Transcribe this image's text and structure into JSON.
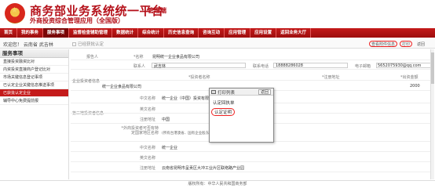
{
  "header": {
    "title": "商务部业务系统统一平台",
    "title_suffix": "管理端",
    "subtitle": "外商投资综合管理应用（全国版）"
  },
  "nav": {
    "items": [
      "首页",
      "我的事务",
      "服务事项",
      "监督检查辅助管理",
      "数据统计",
      "综合统计",
      "历史信息查询",
      "咨询互动",
      "应用管理",
      "应用设置",
      "返回业务大厅"
    ],
    "active_index": 2
  },
  "subbar": {
    "welcome": "欢迎您！ 云南省 武吉林",
    "breadcrumb": "已经获批认定"
  },
  "toolbar": {
    "view_label": "查看附件信息",
    "print_label": "打印",
    "back_label": "返回"
  },
  "sidebar": {
    "heading": "服务事项",
    "items": [
      "直接投资融资比对",
      "内资投资直接商户登记比对",
      "市场关键信息登记事项",
      "已认定企业关键信息推送事项",
      "已获批认定企业",
      "辅导中心免费提前报"
    ],
    "active_index": 4
  },
  "form": {
    "reporter_label": "报告人",
    "enterprise_label": "*名称",
    "enterprise_value": "昆明统一企业食品有限公司",
    "contact_label": "联系人",
    "contact_value": "武吉林",
    "phone_label": "联系电话",
    "phone_value": "18888286028",
    "email_label": "电子邮箱",
    "email_value": "5652075930@qq.com",
    "investor_section_label": "企业投资者信息",
    "investor_name_label": "*投资者名称",
    "investor_reg_label": "*注册地址",
    "investor_amount_label": "*出资金额",
    "investor_name_value": "统一企业食品有限公司",
    "investor_amount_value": "2000",
    "actual_controller_label": "第三地投资者信息",
    "cn_name_label": "中文名称",
    "cn_name_value": "统一企业（中国）投资有限公司",
    "en_name_label": "英文名称",
    "country_label": "注册地址",
    "country_value": "中国",
    "type_label": "*外商投资者可否有特定国家地区名称",
    "type_value": "(所有台港澳省、国有企业股东、投资人及主要财产者、产权人...)",
    "cn_name2_label": "中文名称",
    "cn_name2_value": "统一企业",
    "en_name2_label": "英文名称",
    "reg_addr_label": "注册地址",
    "reg_addr_value": "云南省昆明市呈贡区大冲工业片区联络路产业园"
  },
  "popup": {
    "title": "打印列表",
    "back_label": "返回",
    "items": [
      "认定回执单",
      "认定证明"
    ]
  },
  "footer": {
    "text": "版权所有：中华人民共和国商务部"
  }
}
